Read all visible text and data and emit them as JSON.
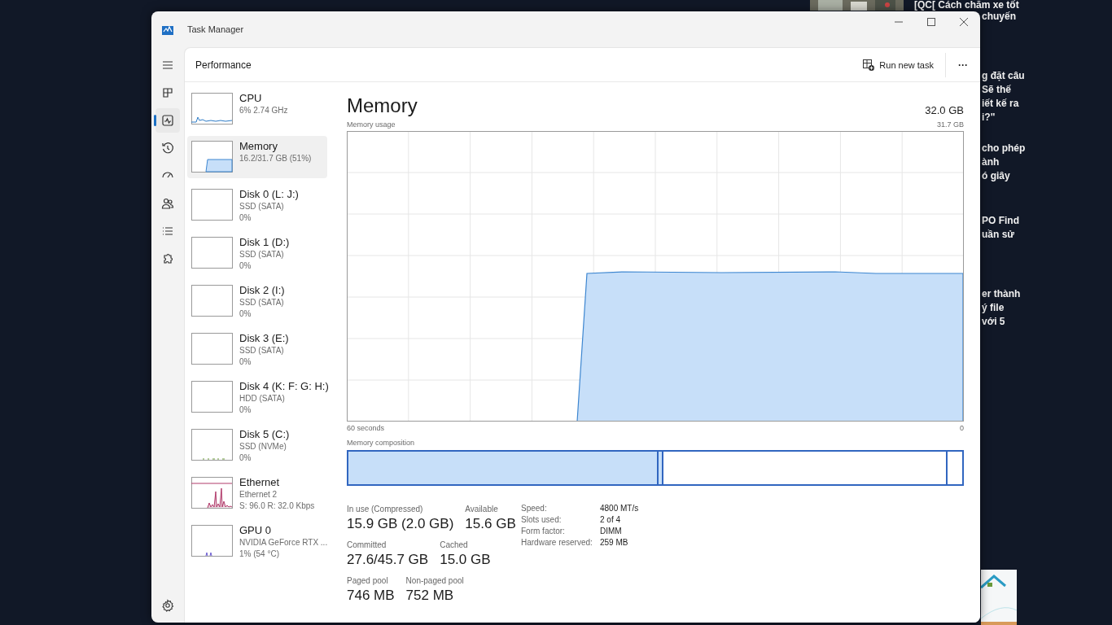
{
  "background": {
    "ad_headline": "[QC[ Cách chăm xe tốt",
    "blocks": [
      {
        "lines": [
          "chuyến"
        ]
      },
      {
        "lines": [
          "g đặt câu",
          "Sẽ thế",
          "iết kế ra",
          "i?\""
        ]
      },
      {
        "lines": [
          "cho phép",
          "ành",
          "ó giây"
        ]
      },
      {
        "lines": [
          "PO Find",
          "uần sử"
        ]
      },
      {
        "lines": [
          "er thành",
          "ý file",
          "với 5"
        ]
      }
    ]
  },
  "window": {
    "title": "Task Manager",
    "page_title": "Performance",
    "run_new_task": "Run new task",
    "more": "···"
  },
  "nav": [
    {
      "kind": "menu",
      "selected": false
    },
    {
      "kind": "processes",
      "selected": false
    },
    {
      "kind": "performance",
      "selected": true
    },
    {
      "kind": "history",
      "selected": false
    },
    {
      "kind": "startup",
      "selected": false
    },
    {
      "kind": "users",
      "selected": false
    },
    {
      "kind": "details",
      "selected": false
    },
    {
      "kind": "services",
      "selected": false
    }
  ],
  "devices": [
    {
      "kind": "cpu",
      "name": "CPU",
      "detail": "6% 2.74 GHz",
      "selected": false
    },
    {
      "kind": "memory",
      "name": "Memory",
      "detail": "16.2/31.7 GB (51%)",
      "selected": true
    },
    {
      "kind": "disk",
      "name": "Disk 0 (L: J:)",
      "detail": "SSD (SATA)",
      "value": "0%",
      "selected": false
    },
    {
      "kind": "disk",
      "name": "Disk 1 (D:)",
      "detail": "SSD (SATA)",
      "value": "0%",
      "selected": false
    },
    {
      "kind": "disk",
      "name": "Disk 2 (I:)",
      "detail": "SSD (SATA)",
      "value": "0%",
      "selected": false
    },
    {
      "kind": "disk",
      "name": "Disk 3 (E:)",
      "detail": "SSD (SATA)",
      "value": "0%",
      "selected": false
    },
    {
      "kind": "disk",
      "name": "Disk 4 (K: F: G: H:)",
      "detail": "HDD (SATA)",
      "value": "0%",
      "selected": false
    },
    {
      "kind": "nvme",
      "name": "Disk 5 (C:)",
      "detail": "SSD (NVMe)",
      "value": "0%",
      "selected": false
    },
    {
      "kind": "ethernet",
      "name": "Ethernet",
      "detail": "Ethernet 2",
      "value": "S: 96.0  R: 32.0 Kbps",
      "selected": false
    },
    {
      "kind": "gpu",
      "name": "GPU 0",
      "detail": "NVIDIA GeForce RTX ...",
      "value": "1% (54 °C)",
      "selected": false
    }
  ],
  "memory": {
    "title": "Memory",
    "total": "32.0 GB",
    "usage_label": "Memory usage",
    "usage_max": "31.7 GB",
    "time_start": "60 seconds",
    "time_end": "0",
    "composition_label": "Memory composition",
    "composition": [
      {
        "kind": "in_use",
        "level": 0.503
      },
      {
        "kind": "modified",
        "level": 0.008
      },
      {
        "kind": "standby"
      },
      {
        "kind": "free",
        "level": 0.027
      }
    ],
    "stats": [
      {
        "items": [
          {
            "label": "In use (Compressed)",
            "value": "15.9 GB (2.0 GB)"
          },
          {
            "label": "Available",
            "value": "15.6 GB"
          }
        ]
      },
      {
        "items": [
          {
            "label": "Committed",
            "value": "27.6/45.7 GB"
          },
          {
            "label": "Cached",
            "value": "15.0 GB"
          }
        ]
      },
      {
        "items": [
          {
            "label": "Paged pool",
            "value": "746 MB"
          },
          {
            "label": "Non-paged pool",
            "value": "752 MB"
          }
        ]
      }
    ],
    "properties": [
      {
        "label": "Speed:",
        "value": "4800 MT/s"
      },
      {
        "label": "Slots used:",
        "value": "2 of 4"
      },
      {
        "label": "Form factor:",
        "value": "DIMM"
      },
      {
        "label": "Hardware reserved:",
        "value": "259 MB"
      }
    ]
  }
}
